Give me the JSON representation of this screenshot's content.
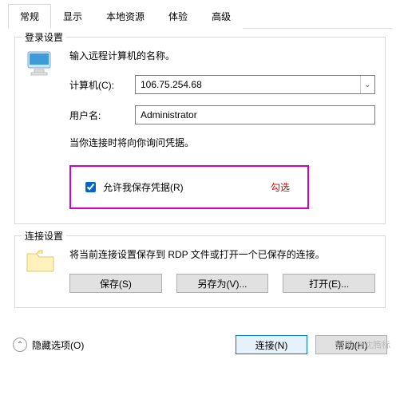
{
  "tabs": [
    "常规",
    "显示",
    "本地资源",
    "体验",
    "高级"
  ],
  "activeTab": 0,
  "login": {
    "legend": "登录设置",
    "instruction": "输入远程计算机的名称。",
    "computer_label": "计算机(C):",
    "computer_value": "106.75.254.68",
    "username_label": "用户名:",
    "username_value": "Administrator",
    "note": "当你连接时将向你询问凭据。",
    "checkbox_label": "允许我保存凭据(R)",
    "checkbox_checked": true,
    "annotation": "勾选"
  },
  "connection": {
    "legend": "连接设置",
    "desc": "将当前连接设置保存到 RDP 文件或打开一个已保存的连接。",
    "save_btn": "保存(S)",
    "saveas_btn": "另存为(V)...",
    "open_btn": "打开(E)..."
  },
  "bottom": {
    "hide_options": "隐藏选项(O)",
    "connect_btn": "连接(N)",
    "help_btn": "帮助(H)"
  },
  "watermark": "知乎 @沈腾标"
}
